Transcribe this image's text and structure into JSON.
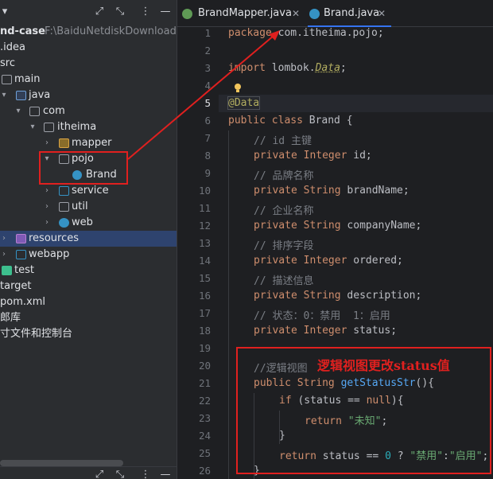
{
  "project_panel": {
    "root_label": "nd-case",
    "root_path": "F:\\BaiduNetdiskDownload\\资",
    "tree": [
      {
        "label": ".idea"
      },
      {
        "label": "src"
      },
      {
        "label": "main"
      },
      {
        "label": "java"
      },
      {
        "label": "com"
      },
      {
        "label": "itheima"
      },
      {
        "label": "mapper"
      },
      {
        "label": "pojo"
      },
      {
        "label": "Brand"
      },
      {
        "label": "service"
      },
      {
        "label": "util"
      },
      {
        "label": "web"
      },
      {
        "label": "resources"
      },
      {
        "label": "webapp"
      },
      {
        "label": "test"
      },
      {
        "label": "target"
      },
      {
        "label": "pom.xml"
      },
      {
        "label": "郎库"
      },
      {
        "label": "寸文件和控制台"
      }
    ]
  },
  "tabs": [
    {
      "label": "BrandMapper.java",
      "active": false
    },
    {
      "label": "Brand.java",
      "active": true
    }
  ],
  "icons": {
    "expand": "expand-icon",
    "collapse": "collapse-icon",
    "more": "more-icon",
    "minimize": "minimize-icon",
    "close": "close-icon"
  },
  "line_numbers": [
    "1",
    "2",
    "3",
    "4",
    "5",
    "6",
    "7",
    "8",
    "9",
    "10",
    "11",
    "12",
    "13",
    "14",
    "15",
    "16",
    "17",
    "18",
    "19",
    "20",
    "21",
    "22",
    "23",
    "24",
    "25",
    "26"
  ],
  "code": {
    "l1_kw": "package",
    "l1_pkg": " com.itheima.pojo;",
    "l3_kw": "import",
    "l3_a": " lombok.",
    "l3_b": "Data",
    "l3_c": ";",
    "l5": "@Data",
    "l6_kw": "public class",
    "l6_b": " Brand {",
    "l7": "// id 主键",
    "l8_kw": "private",
    "l8_ty": " Integer",
    "l8_b": " id;",
    "l9": "// 品牌名称",
    "l10_kw": "private",
    "l10_ty": " String",
    "l10_b": " brandName;",
    "l11": "// 企业名称",
    "l12_kw": "private",
    "l12_ty": " String",
    "l12_b": " companyName;",
    "l13": "// 排序字段",
    "l14_kw": "private",
    "l14_ty": " Integer",
    "l14_b": " ordered;",
    "l15": "// 描述信息",
    "l16_kw": "private",
    "l16_ty": " String",
    "l16_b": " description;",
    "l17": "// 状态：0：禁用  1：启用",
    "l18_kw": "private",
    "l18_ty": " Integer",
    "l18_b": " status;",
    "l20": "//逻辑视图",
    "l21_kw": "public",
    "l21_ty": " String",
    "l21_fn": " getStatusStr",
    "l21_b": "(){",
    "l22_kw": "if",
    "l22_a": " (status == ",
    "l22_null": "null",
    "l22_b": "){",
    "l23_kw": "return",
    "l23_str": " \"未知\"",
    "l23_b": ";",
    "l24": "}",
    "l25_kw": "return",
    "l25_a": " status == ",
    "l25_num": "0",
    "l25_b": " ? ",
    "l25_s1": "\"禁用\"",
    "l25_c": ":",
    "l25_s2": "\"启用\"",
    "l25_d": ";",
    "l26": "}"
  },
  "annotation_note": "逻辑视图更改status值",
  "colors": {
    "accent": "#3574f0",
    "annotation_red": "#e0201f",
    "keyword": "#cf8e6d",
    "comment": "#7a7e85",
    "string": "#6aab73"
  }
}
